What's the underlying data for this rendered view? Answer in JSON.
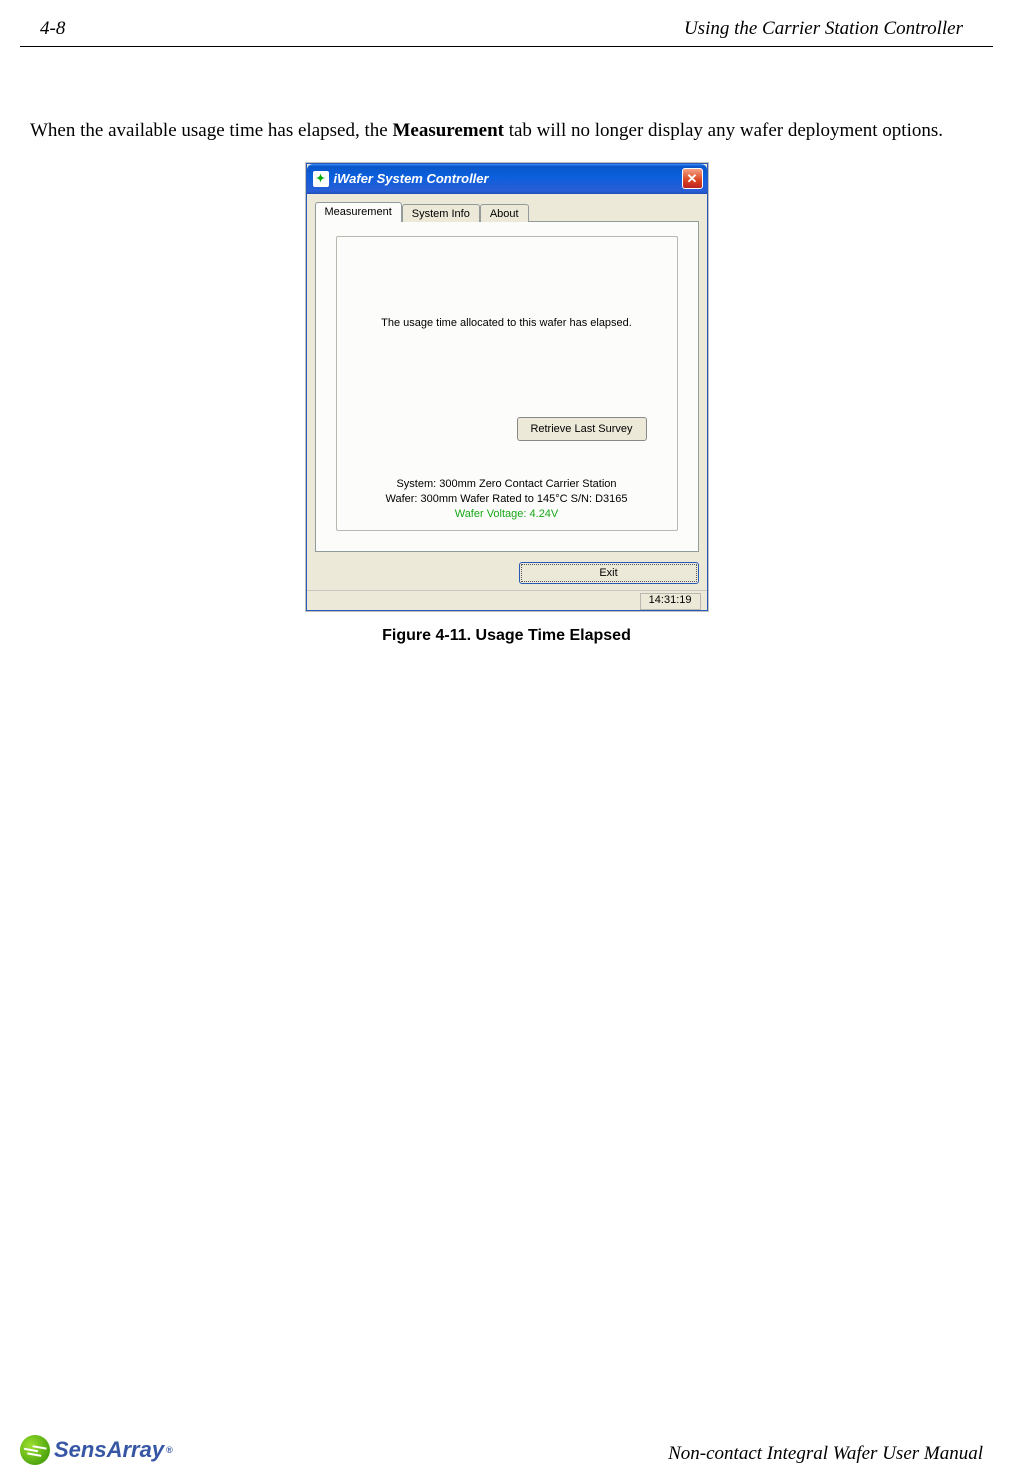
{
  "header": {
    "page_number": "4-8",
    "section_title": "Using the Carrier Station Controller"
  },
  "paragraph": {
    "prefix": "When the available usage time has elapsed, the ",
    "bold": "Measurement",
    "suffix": " tab will no longer display any wafer deployment options."
  },
  "window": {
    "title": "iWafer System Controller",
    "close_label": "✕",
    "tabs": {
      "measurement": "Measurement",
      "system_info": "System Info",
      "about": "About"
    },
    "message": "The usage time allocated to this wafer has elapsed.",
    "retrieve_btn": "Retrieve Last Survey",
    "system_line": "System: 300mm Zero Contact Carrier Station",
    "wafer_line": "Wafer: 300mm Wafer Rated to 145°C S/N: D3165",
    "voltage_line": "Wafer Voltage: 4.24V",
    "exit_btn": "Exit",
    "status_time": "14:31:19"
  },
  "figure_caption": "Figure 4-11. Usage Time Elapsed",
  "footer": {
    "logo_text": "SensArray",
    "tm": "®",
    "manual_title": "Non-contact Integral Wafer User Manual"
  }
}
